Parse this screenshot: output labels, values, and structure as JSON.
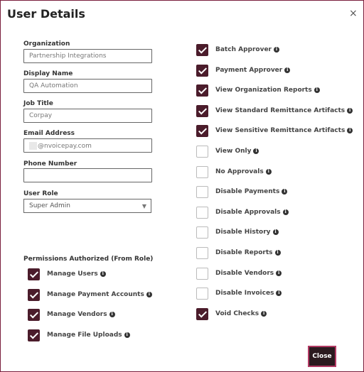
{
  "dialog": {
    "title": "User Details",
    "close_icon": "×",
    "close_button": "Close"
  },
  "fields": {
    "organization": {
      "label": "Organization",
      "value": "Partnership Integrations"
    },
    "display_name": {
      "label": "Display Name",
      "value": "QA Automation"
    },
    "job_title": {
      "label": "Job Title",
      "value": "Corpay"
    },
    "email": {
      "label": "Email Address",
      "value": "@nvoicepay.com"
    },
    "phone": {
      "label": "Phone Number",
      "value": ""
    },
    "user_role": {
      "label": "User Role",
      "value": "Super Admin"
    }
  },
  "permissions_title": "Permissions Authorized  (From Role)",
  "permissions": [
    {
      "label": "Manage Users",
      "checked": true
    },
    {
      "label": "Manage Payment Accounts",
      "checked": true
    },
    {
      "label": "Manage Vendors",
      "checked": true
    },
    {
      "label": "Manage File Uploads",
      "checked": true
    }
  ],
  "roles": [
    {
      "label": "Batch Approver",
      "checked": true
    },
    {
      "label": "Payment Approver",
      "checked": true
    },
    {
      "label": "View Organization Reports",
      "checked": true
    },
    {
      "label": "View Standard Remittance Artifacts",
      "checked": true
    },
    {
      "label": "View Sensitive Remittance Artifacts",
      "checked": true
    },
    {
      "label": "View Only",
      "checked": false
    },
    {
      "label": "No Approvals",
      "checked": false
    },
    {
      "label": "Disable Payments",
      "checked": false
    },
    {
      "label": "Disable Approvals",
      "checked": false
    },
    {
      "label": "Disable History",
      "checked": false
    },
    {
      "label": "Disable Reports",
      "checked": false
    },
    {
      "label": "Disable Vendors",
      "checked": false
    },
    {
      "label": "Disable Invoices",
      "checked": false
    },
    {
      "label": "Void Checks",
      "checked": true
    }
  ],
  "colors": {
    "accent": "#4b1c2b",
    "border": "#7a1f3d",
    "close_border": "#b23a64"
  },
  "icons": {
    "info": "info-icon",
    "caret": "chevron-down-icon"
  }
}
